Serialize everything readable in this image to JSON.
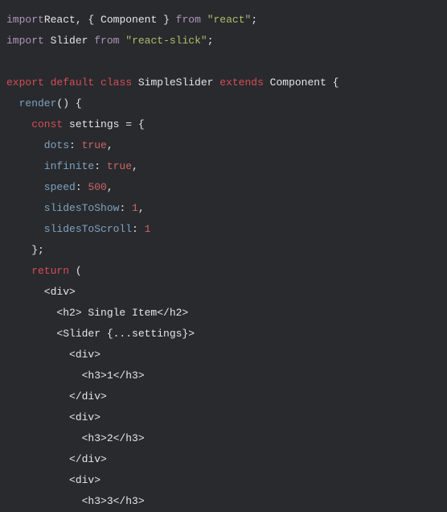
{
  "code": {
    "t_import1": "import",
    "t_React": "React",
    "t_comma1": ", { ",
    "t_Component": "Component",
    "t_close_br1": " } ",
    "t_from1": "from",
    "t_sp1": " ",
    "t_str_react": "\"react\"",
    "t_semi1": ";",
    "t_import2": "import",
    "t_Slider": " Slider ",
    "t_from2": "from",
    "t_sp2": " ",
    "t_str_slick": "\"react-slick\"",
    "t_semi2": ";",
    "t_export": "export",
    "t_default": " default",
    "t_class": " class",
    "t_SimpleSlider": " SimpleSlider ",
    "t_extends": "extends",
    "t_Component2": " Component ",
    "t_brace_open": "{",
    "t_render": "  render",
    "t_render_paren": "() {",
    "t_const": "    const",
    "t_settings": " settings = {",
    "t_dots_k": "      dots",
    "t_colon": ": ",
    "t_true1": "true",
    "t_comma": ",",
    "t_infinite_k": "      infinite",
    "t_true2": "true",
    "t_speed_k": "      speed",
    "t_500": "500",
    "t_slidesToShow_k": "      slidesToShow",
    "t_1a": "1",
    "t_slidesToScroll_k": "      slidesToScroll",
    "t_1b": "1",
    "t_close_obj": "    };",
    "t_return": "    return",
    "t_paren_open": " (",
    "t_div_open": "      <div>",
    "t_h2": "        <h2> Single Item</h2>",
    "t_slider_open": "        <Slider {...settings}>",
    "t_div1_open": "          <div>",
    "t_h3_1": "            <h3>1</h3>",
    "t_div1_close": "          </div>",
    "t_div2_open": "          <div>",
    "t_h3_2": "            <h3>2</h3>",
    "t_div2_close": "          </div>",
    "t_div3_open": "          <div>",
    "t_h3_3": "            <h3>3</h3>"
  }
}
